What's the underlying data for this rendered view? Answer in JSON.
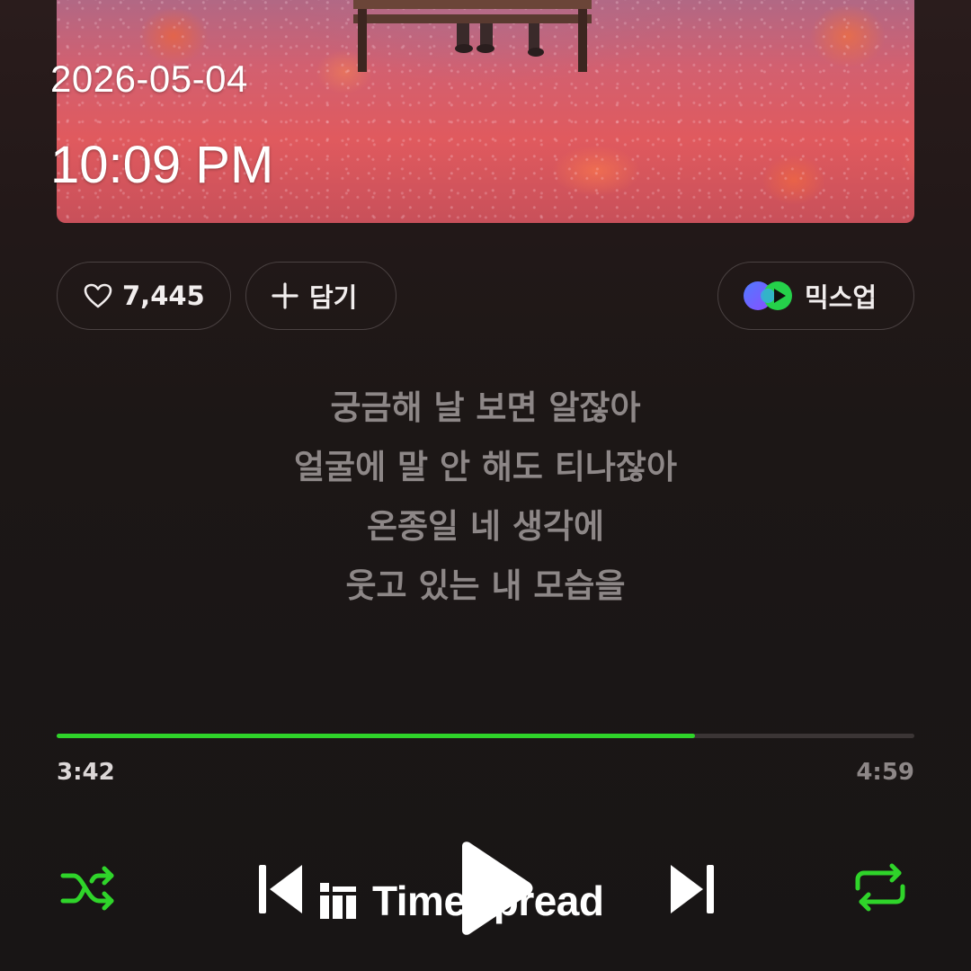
{
  "overlay": {
    "date": "2026-05-04",
    "time": "10:09 PM"
  },
  "actions": {
    "like_count": "7,445",
    "add_label": "담기",
    "mixup_label": "믹스업"
  },
  "lyrics": [
    "궁금해 날 보면 알잖아",
    "얼굴에 말 안 해도 티나잖아",
    "온종일 네 생각에",
    "웃고 있는 내 모습을"
  ],
  "progress": {
    "current": "3:42",
    "total": "4:59",
    "fraction": 0.744
  },
  "controls": {
    "shuffle_icon": "shuffle-icon",
    "prev_icon": "skip-previous-icon",
    "play_icon": "play-icon",
    "next_icon": "skip-next-icon",
    "repeat_icon": "repeat-icon"
  },
  "watermark": {
    "text": "TimeSpread"
  },
  "colors": {
    "accent_green": "#2fd42a",
    "lyric_gray": "#8d8787",
    "background": "#181515"
  }
}
